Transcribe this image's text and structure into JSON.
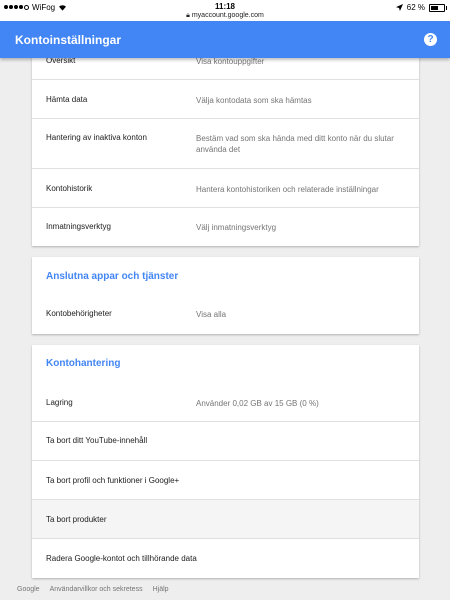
{
  "statusbar": {
    "carrier": "WiFog",
    "time": "11:18",
    "url": "myaccount.google.com",
    "battery": "62 %",
    "battery_level": 0.62
  },
  "appbar": {
    "title": "Kontoinställningar",
    "help_symbol": "?"
  },
  "settings_card": {
    "rows": [
      {
        "label": "Översikt",
        "value": "Visa kontouppgifter"
      },
      {
        "label": "Hämta data",
        "value": "Välja kontodata som ska hämtas"
      },
      {
        "label": "Hantering av inaktiva konton",
        "value": "Bestäm vad som ska hända med ditt konto när du slutar använda det"
      },
      {
        "label": "Kontohistorik",
        "value": "Hantera kontohistoriken och relaterade inställningar"
      },
      {
        "label": "Inmatningsverktyg",
        "value": "Välj inmatningsverktyg"
      }
    ]
  },
  "apps_card": {
    "title": "Anslutna appar och tjänster",
    "rows": [
      {
        "label": "Kontobehörigheter",
        "value": "Visa alla"
      }
    ]
  },
  "management_card": {
    "title": "Kontohantering",
    "rows": [
      {
        "label": "Lagring",
        "value": "Använder 0,02 GB av 15 GB (0 %)"
      },
      {
        "label": "Ta bort ditt YouTube-innehåll",
        "value": ""
      },
      {
        "label": "Ta bort profil och funktioner i Google+",
        "value": ""
      },
      {
        "label": "Ta bort produkter",
        "value": ""
      },
      {
        "label": "Radera Google-kontot och tillhörande data",
        "value": ""
      }
    ]
  },
  "footer": {
    "links": [
      "Google",
      "Användarvillkor och sekretess",
      "Hjälp"
    ]
  }
}
